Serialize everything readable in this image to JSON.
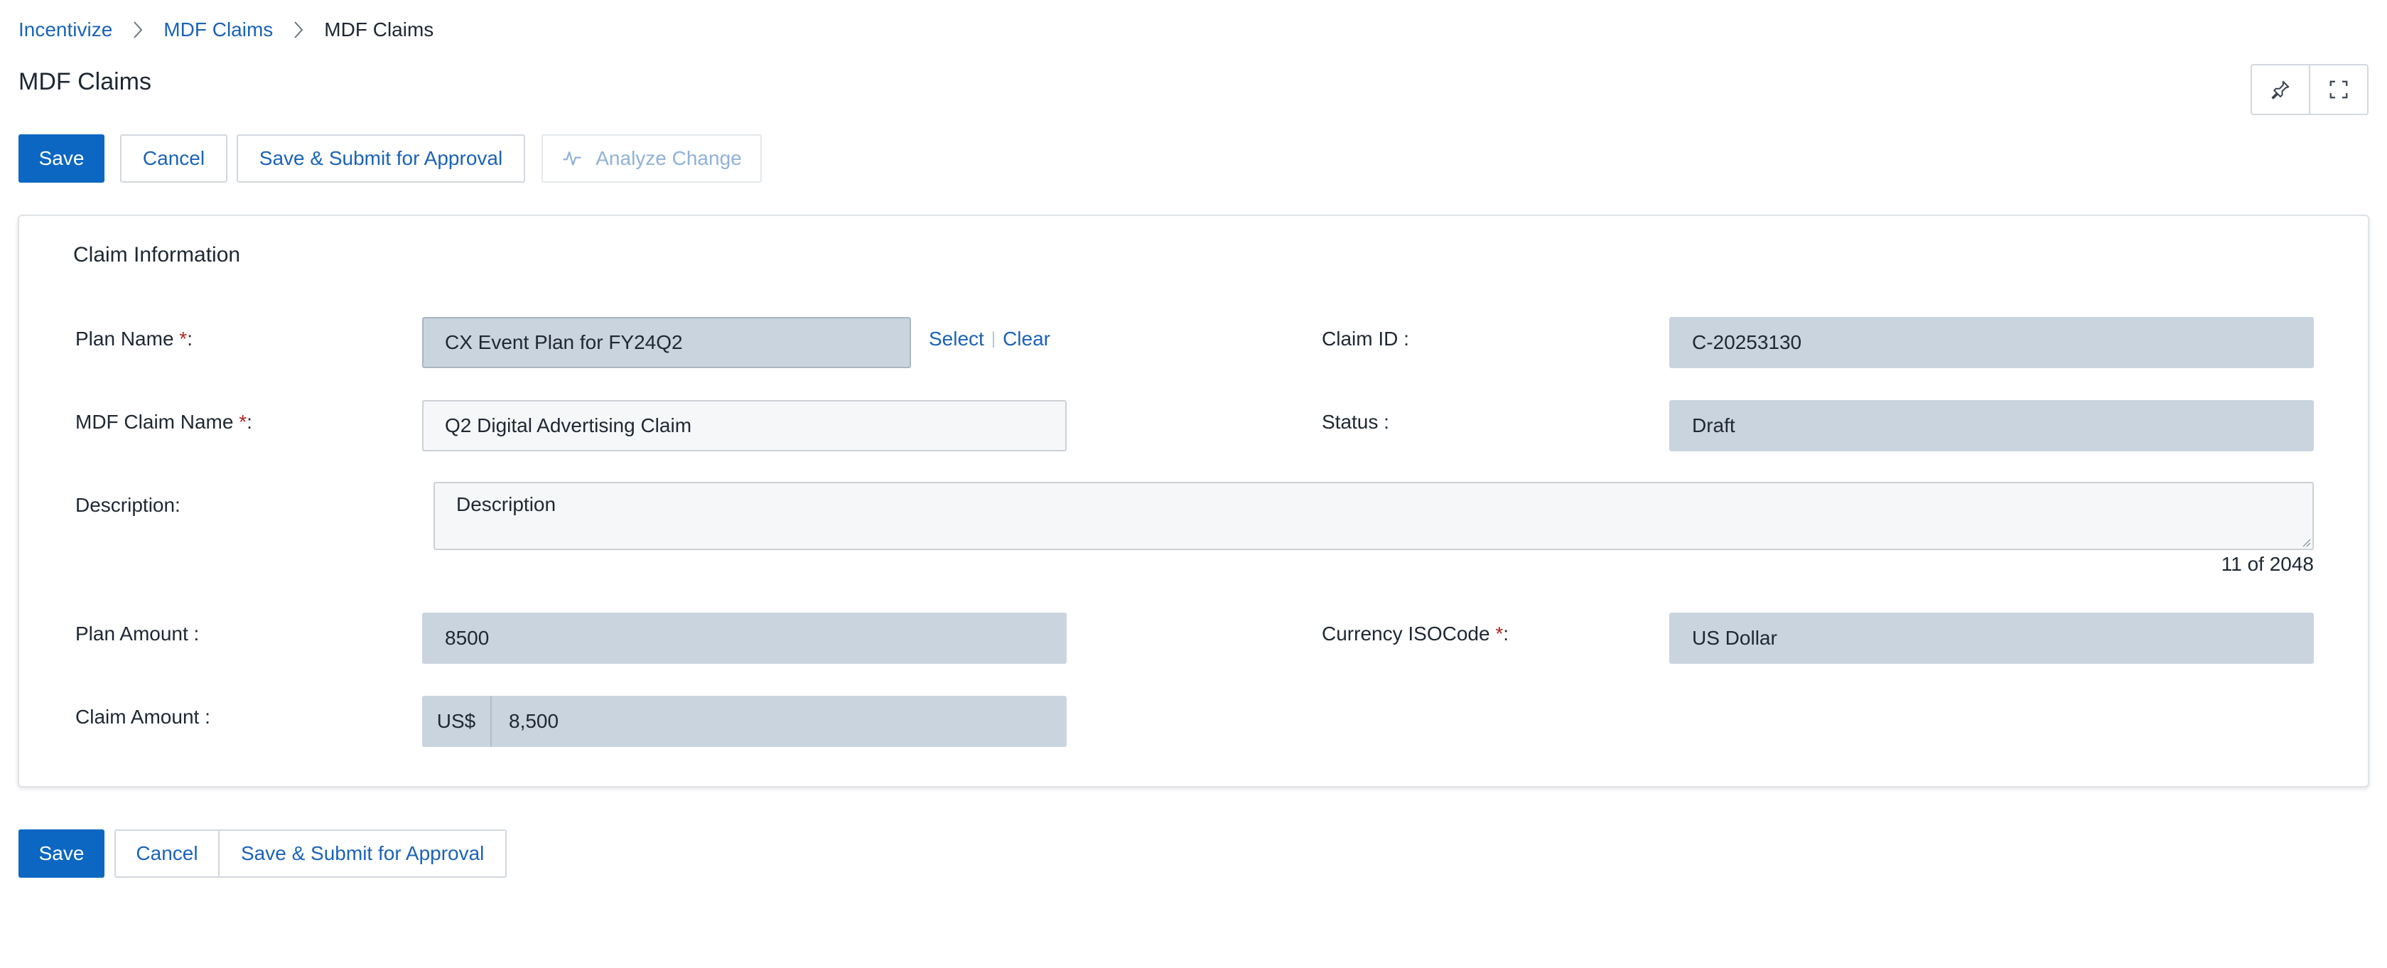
{
  "breadcrumb": {
    "items": [
      "Incentivize",
      "MDF Claims"
    ],
    "current": "MDF Claims"
  },
  "page": {
    "title": "MDF Claims"
  },
  "icons": {
    "pin": "pin-icon",
    "fullscreen": "fullscreen-icon",
    "analyze": "activity-icon",
    "breadcrumb_separator": "chevron-right-icon"
  },
  "toolbar": {
    "save_label": "Save",
    "cancel_label": "Cancel",
    "submit_label": "Save & Submit for Approval",
    "analyze_label": "Analyze Change"
  },
  "section": {
    "title": "Claim Information"
  },
  "fields": {
    "plan_name": {
      "label": "Plan Name ",
      "required": "*",
      "suffix": ":",
      "value": "CX Event Plan for FY24Q2",
      "select_label": "Select",
      "clear_label": "Clear",
      "separator": "|"
    },
    "claim_id": {
      "label": "Claim ID :",
      "value": "C-20253130"
    },
    "mdf_claim_name": {
      "label": "MDF Claim Name ",
      "required": "*",
      "suffix": ":",
      "value": "Q2 Digital Advertising Claim"
    },
    "status": {
      "label": "Status :",
      "value": "Draft"
    },
    "description": {
      "label": "Description:",
      "value": "Description",
      "counter": "11 of 2048"
    },
    "plan_amount": {
      "label": "Plan Amount :",
      "value": "8500"
    },
    "currency": {
      "label": "Currency ISOCode ",
      "required": "*",
      "suffix": ":",
      "value": "US Dollar"
    },
    "claim_amount": {
      "label": "Claim Amount :",
      "prefix": "US$",
      "value": "8,500"
    }
  },
  "colors": {
    "primary": "#0b67c2",
    "link": "#1b63b8",
    "readonly_bg": "#c9d4de",
    "required": "#b3261e"
  }
}
